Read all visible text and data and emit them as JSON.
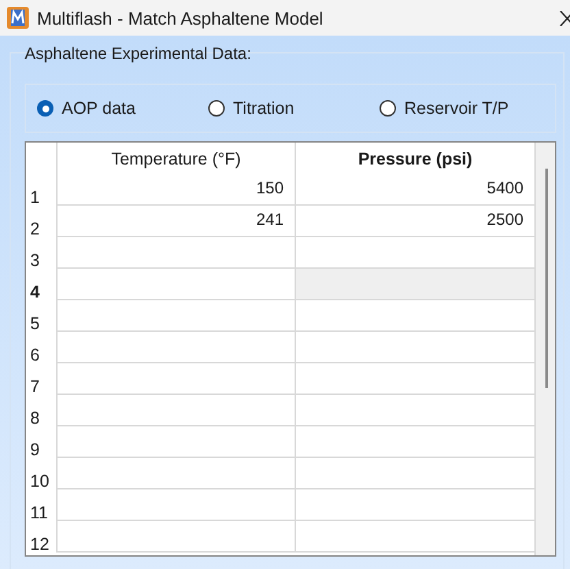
{
  "window": {
    "title": "Multiflash - Match Asphaltene Model"
  },
  "group": {
    "label": "Asphaltene Experimental Data:"
  },
  "options": [
    {
      "label": "AOP data",
      "selected": true
    },
    {
      "label": "Titration",
      "selected": false
    },
    {
      "label": "Reservoir T/P",
      "selected": false
    }
  ],
  "table": {
    "columns": [
      {
        "label": "Temperature (°F)",
        "selected": false
      },
      {
        "label": "Pressure (psi)",
        "selected": true
      }
    ],
    "rows": [
      {
        "label": "1",
        "selected": false,
        "cells": [
          {
            "value": "150",
            "selected": false
          },
          {
            "value": "5400",
            "selected": false
          }
        ]
      },
      {
        "label": "2",
        "selected": false,
        "cells": [
          {
            "value": "241",
            "selected": false
          },
          {
            "value": "2500",
            "selected": false
          }
        ]
      },
      {
        "label": "3",
        "selected": false,
        "cells": [
          {
            "selected": false
          },
          {
            "selected": false
          }
        ]
      },
      {
        "label": "4",
        "selected": true,
        "cells": [
          {
            "selected": false
          },
          {
            "selected": true
          }
        ]
      },
      {
        "label": "5",
        "selected": false,
        "cells": [
          {
            "selected": false
          },
          {
            "selected": false
          }
        ]
      },
      {
        "label": "6",
        "selected": false,
        "cells": [
          {
            "selected": false
          },
          {
            "selected": false
          }
        ]
      },
      {
        "label": "7",
        "selected": false,
        "cells": [
          {
            "selected": false
          },
          {
            "selected": false
          }
        ]
      },
      {
        "label": "8",
        "selected": false,
        "cells": [
          {
            "selected": false
          },
          {
            "selected": false
          }
        ]
      },
      {
        "label": "9",
        "selected": false,
        "cells": [
          {
            "selected": false
          },
          {
            "selected": false
          }
        ]
      },
      {
        "label": "10",
        "selected": false,
        "cells": [
          {
            "selected": false
          },
          {
            "selected": false
          }
        ]
      },
      {
        "label": "11",
        "selected": false,
        "cells": [
          {
            "selected": false
          },
          {
            "selected": false
          }
        ]
      },
      {
        "label": "12",
        "selected": false,
        "cells": [
          {
            "selected": false
          },
          {
            "selected": false
          }
        ]
      }
    ]
  }
}
